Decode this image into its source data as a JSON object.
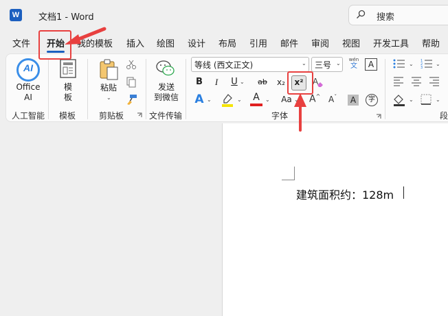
{
  "app": {
    "logo_letter": "W",
    "doc_title": "文档1 - Word",
    "search_placeholder": "搜索"
  },
  "menu": {
    "tabs": [
      "文件",
      "开始",
      "我的模板",
      "插入",
      "绘图",
      "设计",
      "布局",
      "引用",
      "邮件",
      "审阅",
      "视图",
      "开发工具",
      "帮助"
    ],
    "active": "开始"
  },
  "ribbon": {
    "office_ai": {
      "label_line1": "Office",
      "label_line2": "AI",
      "icon_text": "AI",
      "group": "人工智能"
    },
    "template": {
      "label_line1": "模",
      "label_line2": "板",
      "group": "模板"
    },
    "clipboard": {
      "paste_label": "粘贴",
      "group": "剪贴板"
    },
    "transfer": {
      "label_line1": "发送",
      "label_line2": "到微信",
      "group": "文件传输"
    },
    "font": {
      "name": "等线 (西文正文)",
      "size": "三号",
      "phonetic_top": "wén",
      "phonetic_bottom": "文",
      "char_border": "A",
      "bold": "B",
      "italic": "I",
      "underline": "U",
      "strike": "ab",
      "subscript": "x₂",
      "superscript": "x²",
      "clear": "A",
      "text_effect": "A",
      "font_color": "A",
      "case": "Aa",
      "grow": "A",
      "shrink": "A",
      "shade": "A",
      "enclosed": "字",
      "group": "字体"
    },
    "paragraph": {
      "group": "段"
    }
  },
  "colors": {
    "accent": "#1a5fbf",
    "annotation": "#e8403f",
    "highlight": "#f5e400",
    "font_color_bar": "#e02020"
  },
  "document": {
    "text": "建筑面积约：128m"
  }
}
